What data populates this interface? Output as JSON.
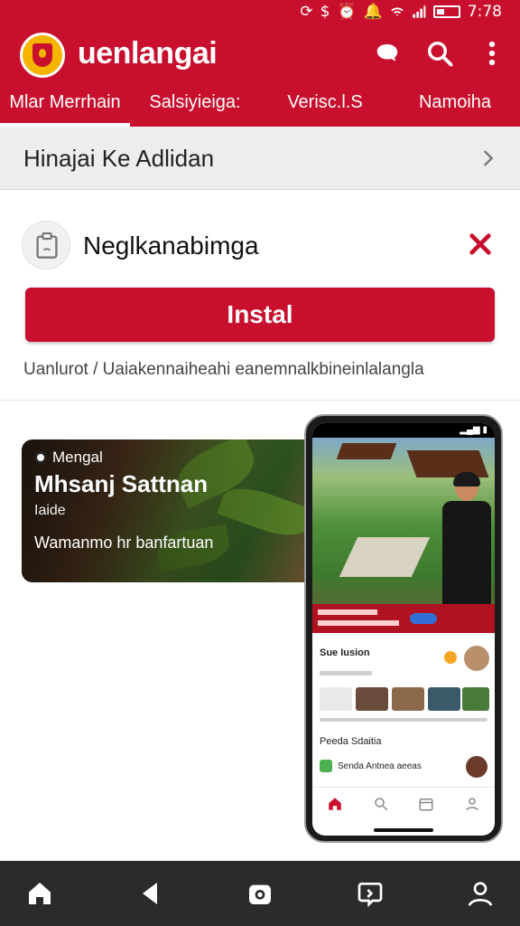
{
  "status_bar": {
    "time": "7:78",
    "icons": [
      "sync-icon",
      "dollar-icon",
      "alarm-icon",
      "notification-icon",
      "wifi-icon",
      "signal-icon",
      "battery-icon"
    ]
  },
  "app_bar": {
    "title": "uenlangai",
    "icons": [
      "logo-icon",
      "chat-icon",
      "search-icon",
      "more-vert-icon"
    ],
    "tabs": [
      {
        "label": "Mlar Merrhain",
        "active": true
      },
      {
        "label": "Salsiyieiga:",
        "active": false
      },
      {
        "label": "Verisc.l.S",
        "active": false
      },
      {
        "label": "Namoiha",
        "active": false
      }
    ]
  },
  "section": {
    "title": "Hinajai Ke Adlidan"
  },
  "install_card": {
    "app_name": "Neglkanabimga",
    "button_label": "Instal",
    "breadcrumb": "Uanlurot  /  Uaiakennaiheahi eanemnalkbineinlalangla"
  },
  "promo": {
    "tag": "Mengal",
    "title": "Mhsanj Sattnan",
    "subtitle": "Iaide",
    "description": "Wamanmo hr banfartuan"
  },
  "phone_preview": {
    "status": "▂▄▆ ▮",
    "row1": "Sue Iusion",
    "row2": "Peeda Sdaitia",
    "row3": "Senda Antnea aeeas"
  },
  "colors": {
    "accent": "#c8102e",
    "nav_bg": "#2b2b2b",
    "section_bg": "#ededed"
  }
}
